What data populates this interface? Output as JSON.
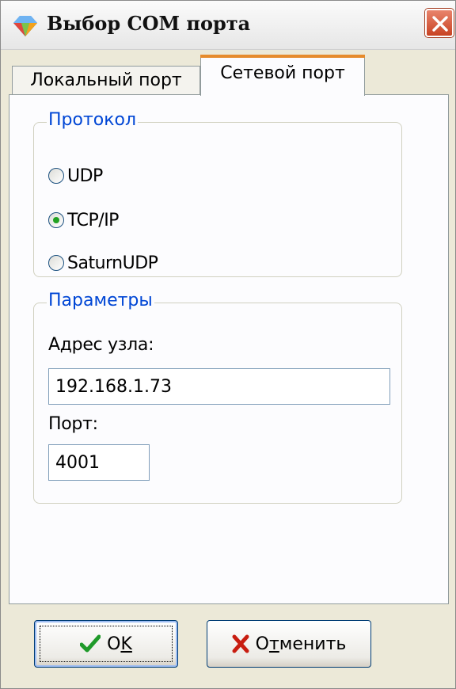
{
  "window": {
    "title": "Выбор COM порта",
    "icon": "app-diamond-icon",
    "close_icon": "close-icon"
  },
  "tabs": [
    {
      "label": "Локальный порт",
      "selected": false
    },
    {
      "label": "Сетевой порт",
      "selected": true
    }
  ],
  "protocol_group": {
    "legend": "Протокол",
    "options": [
      {
        "label": "UDP",
        "checked": false
      },
      {
        "label": "TCP/IP",
        "checked": true
      },
      {
        "label": "SaturnUDP",
        "checked": false
      }
    ]
  },
  "params_group": {
    "legend": "Параметры",
    "host_label": "Адрес узла:",
    "host_value": "192.168.1.73",
    "port_label": "Порт:",
    "port_value": "4001"
  },
  "buttons": {
    "ok": {
      "label_pre": "O",
      "label_underlined": "K",
      "label_post": "",
      "icon": "checkmark-icon"
    },
    "cancel": {
      "label_pre": "О",
      "label_underlined": "т",
      "label_post": "менить",
      "icon": "x-mark-icon"
    }
  },
  "colors": {
    "legend": "#0046d5",
    "selected_tab_accent": "#e68b2c",
    "close_button": "#c84323",
    "radio_dot": "#21a121"
  }
}
